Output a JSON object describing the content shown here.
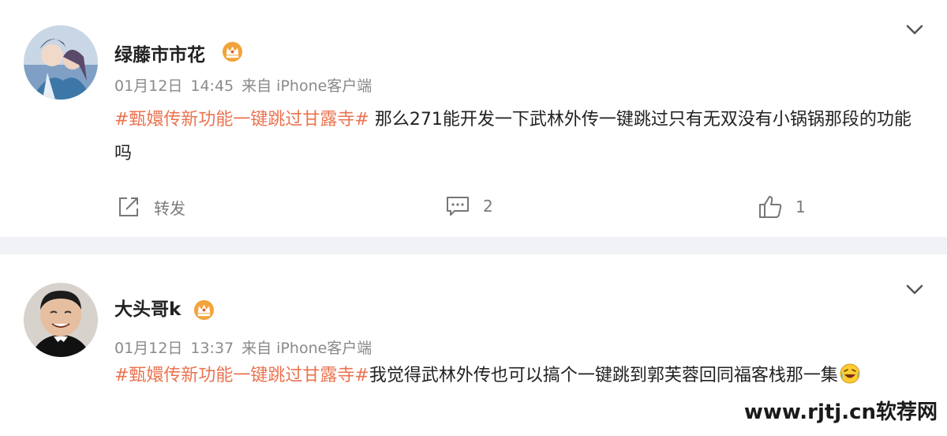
{
  "posts": [
    {
      "username": "绿藤市市花",
      "date": "01月12日",
      "time": "14:45",
      "source": "来自 iPhone客户端",
      "topic": "#甄嬛传新功能一键跳过甘露寺#",
      "text": " 那么271能开发一下武林外传一键跳过只有无双没有小锅锅那段的功能吗",
      "repost_label": "转发",
      "comment_count": "2",
      "like_count": "1"
    },
    {
      "username": "大头哥k",
      "date": "01月12日",
      "time": "13:37",
      "source": "来自 iPhone客户端",
      "topic": "#甄嬛传新功能一键跳过甘露寺#",
      "text": "我觉得武林外传也可以搞个一键跳到郭芙蓉回同福客栈那一集"
    }
  ],
  "watermark": "www.rjtj.cn软荐网",
  "icons": {
    "badge": "crown-badge-icon",
    "more": "chevron-down-icon",
    "repost": "repost-icon",
    "comment": "comment-icon",
    "like": "thumbs-up-icon",
    "emoji": "laughing-crying-emoji"
  },
  "colors": {
    "topic": "#eb7350",
    "badge": "#f2a33a",
    "meta": "#8a8a8a",
    "page_bg": "#f1f2f5"
  }
}
